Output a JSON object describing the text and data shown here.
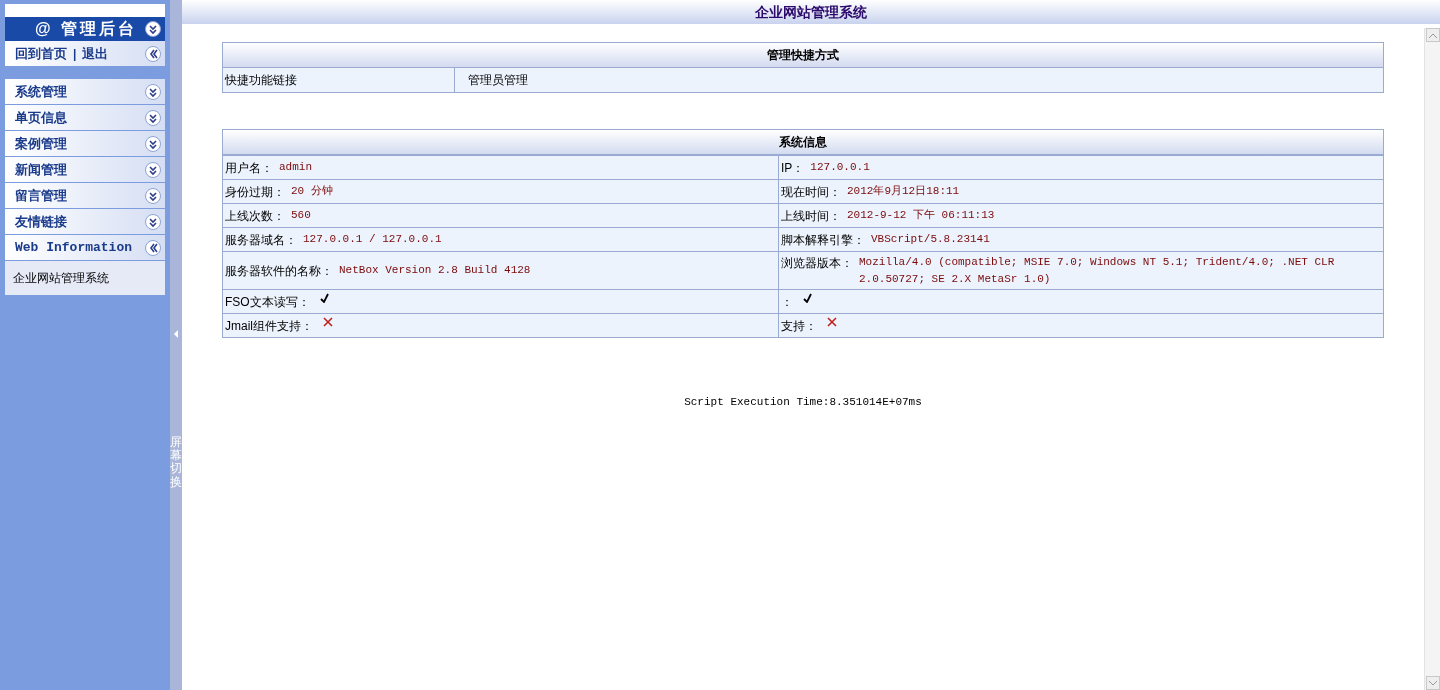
{
  "header": {
    "title": "企业网站管理系统"
  },
  "sidebar": {
    "brand": "@ 管理后台",
    "top_links": [
      "回到首页",
      "退出"
    ],
    "separator": "|",
    "menus": [
      {
        "label": "系统管理",
        "expanded": false
      },
      {
        "label": "单页信息",
        "expanded": false
      },
      {
        "label": "案例管理",
        "expanded": false
      },
      {
        "label": "新闻管理",
        "expanded": false
      },
      {
        "label": "留言管理",
        "expanded": false
      },
      {
        "label": "友情链接",
        "expanded": false
      },
      {
        "label": "Web Information",
        "expanded": true,
        "children": [
          {
            "label": "企业网站管理系统"
          }
        ]
      }
    ]
  },
  "splitter": {
    "label": "屏幕切换"
  },
  "shortcuts": {
    "title": "管理快捷方式",
    "label": "快捷功能链接",
    "links": [
      "管理员管理"
    ]
  },
  "system_info": {
    "title": "系统信息",
    "rows": [
      [
        {
          "label": "用户名：",
          "kind": "text",
          "value": "admin"
        },
        {
          "label": "IP：",
          "kind": "text",
          "value": "127.0.0.1"
        }
      ],
      [
        {
          "label": "身份过期：",
          "kind": "text",
          "value": "20 分钟"
        },
        {
          "label": "现在时间：",
          "kind": "text",
          "value": "2012年9月12日18:11"
        }
      ],
      [
        {
          "label": "上线次数：",
          "kind": "text",
          "value": "560"
        },
        {
          "label": "上线时间：",
          "kind": "text",
          "value": "2012-9-12 下午 06:11:13"
        }
      ],
      [
        {
          "label": "服务器域名：",
          "kind": "text",
          "value": "127.0.0.1 / 127.0.0.1"
        },
        {
          "label": "脚本解释引擎：",
          "kind": "text",
          "value": "VBScript/5.8.23141"
        }
      ],
      [
        {
          "label": "服务器软件的名称：",
          "kind": "text",
          "value": "NetBox Version 2.8 Build 4128"
        },
        {
          "label": "浏览器版本：",
          "kind": "text",
          "value": "Mozilla/4.0 (compatible; MSIE 7.0; Windows NT 5.1; Trident/4.0; .NET CLR 2.0.50727; SE 2.X MetaSr 1.0)"
        }
      ],
      [
        {
          "label": "FSO文本读写：",
          "kind": "check"
        },
        {
          "label": "：",
          "kind": "check"
        }
      ],
      [
        {
          "label": "Jmail组件支持：",
          "kind": "cross"
        },
        {
          "label": "支持：",
          "kind": "cross"
        }
      ]
    ]
  },
  "footer": {
    "execution_time": "Script Execution Time:8.351014E+07ms"
  }
}
